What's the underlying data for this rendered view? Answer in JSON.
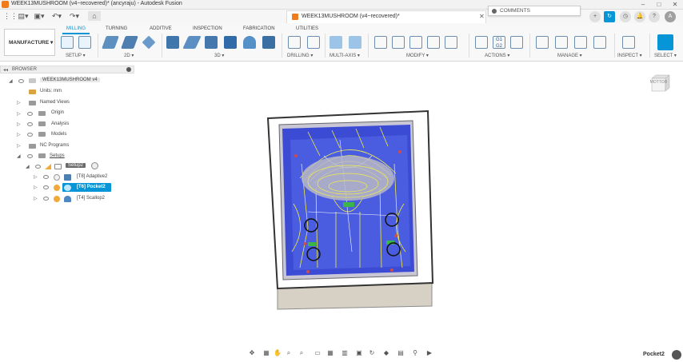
{
  "window": {
    "title": "WEEK13MUSHROOM (v4~recovered)* (ancyraju) - Autodesk Fusion",
    "min_label": "–",
    "max_label": "□",
    "close_label": "✕"
  },
  "document_tab": {
    "label": "WEEK13MUSHROOM (v4~recovered)*",
    "close_label": "✕"
  },
  "comments": {
    "label": "COMMENTS"
  },
  "workspace": {
    "label": "MANUFACTURE ▾"
  },
  "ribbon": {
    "tabs": [
      {
        "label": "MILLING",
        "active": true
      },
      {
        "label": "TURNING"
      },
      {
        "label": "ADDITIVE"
      },
      {
        "label": "INSPECTION"
      },
      {
        "label": "FABRICATION"
      },
      {
        "label": "UTILITIES"
      }
    ],
    "groups": [
      {
        "label": "SETUP ▾"
      },
      {
        "label": "2D ▾"
      },
      {
        "label": "3D ▾"
      },
      {
        "label": "DRILLING ▾"
      },
      {
        "label": "MULTI-AXIS ▾"
      },
      {
        "label": "MODIFY ▾"
      },
      {
        "label": "ACTIONS ▾"
      },
      {
        "label": "MANAGE ▾"
      },
      {
        "label": "INSPECT ▾"
      },
      {
        "label": "SELECT ▾"
      }
    ]
  },
  "browser": {
    "header": "BROWSER",
    "root": "WEEK13MUSHROOM v4",
    "units": "Units: mm",
    "items": [
      {
        "label": "Named Views"
      },
      {
        "label": "Origin"
      },
      {
        "label": "Analysis"
      },
      {
        "label": "Models"
      },
      {
        "label": "NC Programs"
      },
      {
        "label": "Setups"
      }
    ],
    "setup": {
      "label": "Setup2"
    },
    "operations": [
      {
        "label": "[T8] Adaptive2"
      },
      {
        "label": "[T6] Pocket2"
      },
      {
        "label": "[T4] Scallop2"
      }
    ]
  },
  "viewcube": {
    "label": "BOTTOM"
  },
  "status": {
    "selected": "Pocket2"
  },
  "colors": {
    "accent": "#0696d7",
    "toolpath_blue": "#3d4fd6",
    "toolpath_yellow": "#f2ee4a",
    "stock_gray": "#d9d3c8"
  }
}
